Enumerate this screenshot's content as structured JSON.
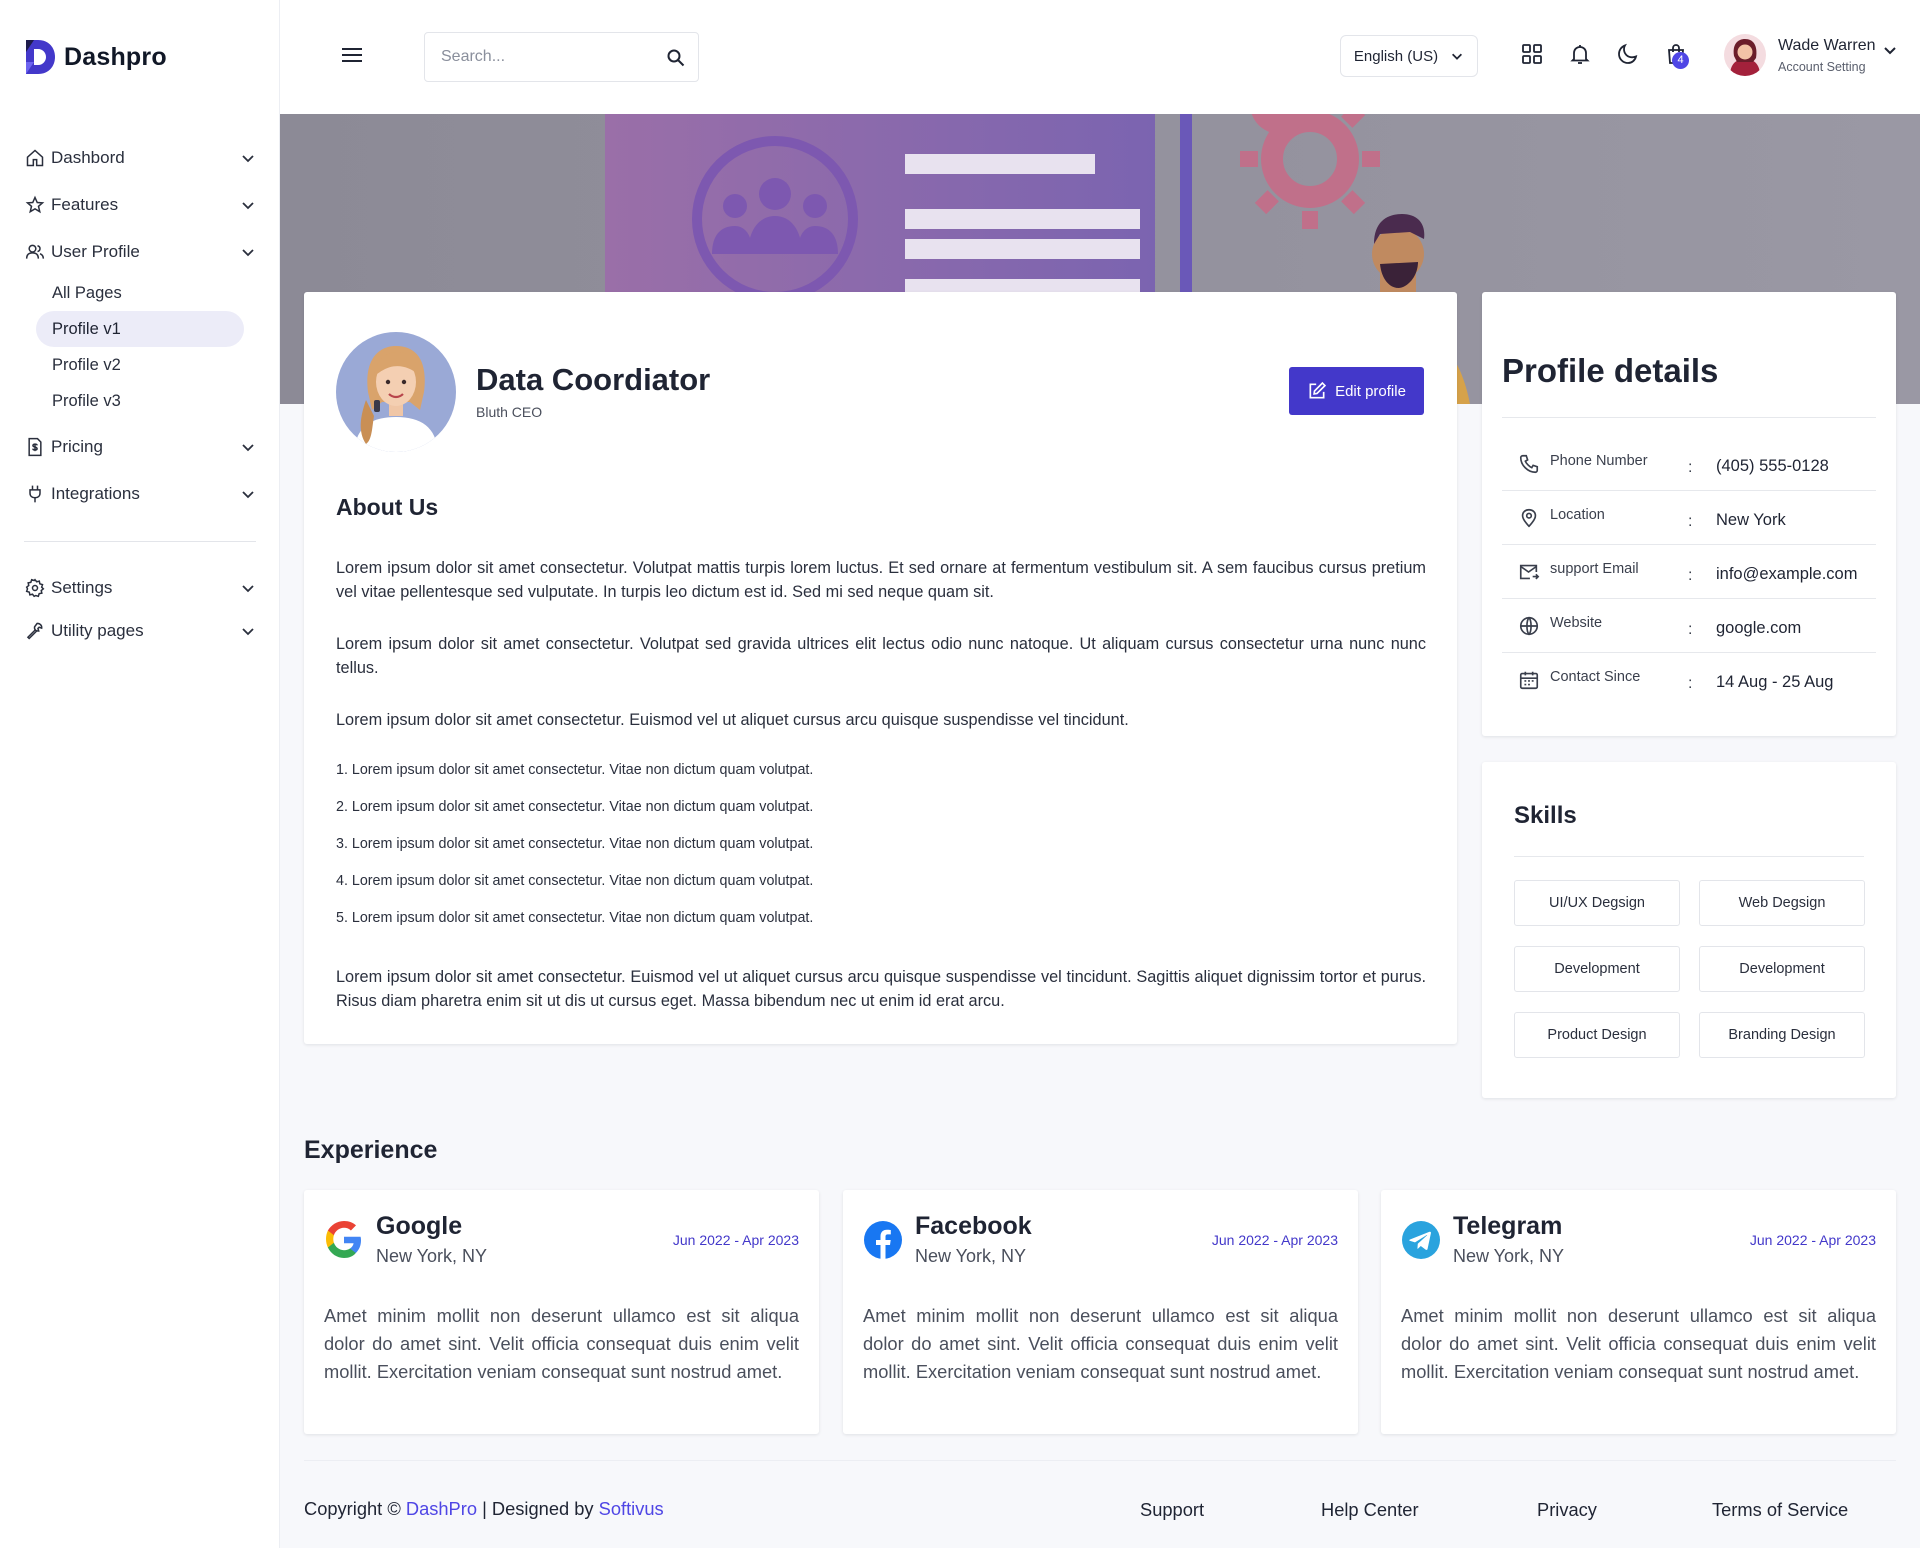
{
  "brand": {
    "name": "Dashpro"
  },
  "search": {
    "placeholder": "Search..."
  },
  "header": {
    "language": "English (US)",
    "cart_badge": "4",
    "user_name": "Wade Warren",
    "user_sub": "Account Setting"
  },
  "sidebar": {
    "items": [
      {
        "label": "Dashbord",
        "icon": "home-icon"
      },
      {
        "label": "Features",
        "icon": "star-icon"
      },
      {
        "label": "User Profile",
        "icon": "users-icon"
      },
      {
        "label": "Pricing",
        "icon": "receipt-icon"
      },
      {
        "label": "Integrations",
        "icon": "plug-icon"
      },
      {
        "label": "Settings",
        "icon": "gear-icon"
      },
      {
        "label": "Utility pages",
        "icon": "wrench-icon"
      }
    ],
    "subitems": [
      "All Pages",
      "Profile v1",
      "Profile v2",
      "Profile v3"
    ],
    "active_subitem": "Profile v1"
  },
  "profile": {
    "title": "Data Coordiator",
    "subtitle": "Bluth CEO",
    "edit_label": "Edit profile",
    "about_heading": "About Us",
    "paragraphs": [
      "Lorem ipsum dolor sit amet consectetur. Volutpat mattis turpis lorem luctus. Et sed ornare at fermentum vestibulum sit. A sem faucibus cursus pretium vel vitae pellentesque sed vulputate. In turpis leo dictum est id. Sed mi sed neque quam sit.",
      "Lorem ipsum dolor sit amet consectetur. Volutpat sed gravida ultrices elit lectus odio nunc natoque. Ut aliquam cursus consectetur urna nunc nunc tellus.",
      "Lorem ipsum dolor sit amet consectetur. Euismod vel ut aliquet cursus arcu quisque suspendisse vel tincidunt."
    ],
    "list": [
      "1. Lorem ipsum dolor sit amet consectetur. Vitae non dictum quam volutpat.",
      "2. Lorem ipsum dolor sit amet consectetur. Vitae non dictum quam volutpat.",
      "3. Lorem ipsum dolor sit amet consectetur. Vitae non dictum quam volutpat.",
      "4. Lorem ipsum dolor sit amet consectetur. Vitae non dictum quam volutpat.",
      "5. Lorem ipsum dolor sit amet consectetur. Vitae non dictum quam volutpat."
    ],
    "closing": "Lorem ipsum dolor sit amet consectetur. Euismod vel ut aliquet cursus arcu quisque suspendisse vel tincidunt. Sagittis aliquet dignissim tortor et purus. Risus diam pharetra enim sit ut dis ut cursus eget. Massa bibendum nec ut enim id erat arcu."
  },
  "details": {
    "heading": "Profile details",
    "rows": [
      {
        "label": "Phone Number",
        "value": "(405) 555-0128",
        "icon": "phone-icon"
      },
      {
        "label": "Location",
        "value": "New York",
        "icon": "location-pin-icon"
      },
      {
        "label": "support Email",
        "value": "info@example.com",
        "icon": "mail-icon"
      },
      {
        "label": "Website",
        "value": "google.com",
        "icon": "globe-icon"
      },
      {
        "label": "Contact Since",
        "value": "14 Aug - 25 Aug",
        "icon": "calendar-icon"
      }
    ],
    "colon": ":"
  },
  "skills": {
    "heading": "Skills",
    "items": [
      "UI/UX Degsign",
      "Web Degsign",
      "Development",
      "Development",
      "Product Design",
      "Branding Design"
    ]
  },
  "experience": {
    "heading": "Experience",
    "items": [
      {
        "company": "Google",
        "location": "New York, NY",
        "dates": "Jun 2022 - Apr 2023",
        "icon": "google-logo-icon",
        "body": "Amet minim mollit non deserunt ullamco est sit aliqua dolor do amet sint. Velit officia consequat duis enim velit mollit. Exercitation veniam consequat sunt nostrud amet."
      },
      {
        "company": "Facebook",
        "location": "New York, NY",
        "dates": "Jun 2022 - Apr 2023",
        "icon": "facebook-logo-icon",
        "body": "Amet minim mollit non deserunt ullamco est sit aliqua dolor do amet sint. Velit officia consequat duis enim velit mollit. Exercitation veniam consequat sunt nostrud amet."
      },
      {
        "company": "Telegram",
        "location": "New York, NY",
        "dates": "Jun 2022 - Apr 2023",
        "icon": "telegram-logo-icon",
        "body": "Amet minim mollit non deserunt ullamco est sit aliqua dolor do amet sint. Velit officia consequat duis enim velit mollit. Exercitation veniam consequat sunt nostrud amet."
      }
    ]
  },
  "footer": {
    "copyright_prefix": "Copyright © ",
    "copyright_brand": "DashPro",
    "copyright_mid": " | Designed by ",
    "copyright_author": "Softivus",
    "links": [
      "Support",
      "Help Center",
      "Privacy",
      "Terms of Service"
    ]
  },
  "colors": {
    "accent": "#4338ca",
    "badge": "#4f46e5",
    "active_nav_bg": "#ececf8"
  }
}
